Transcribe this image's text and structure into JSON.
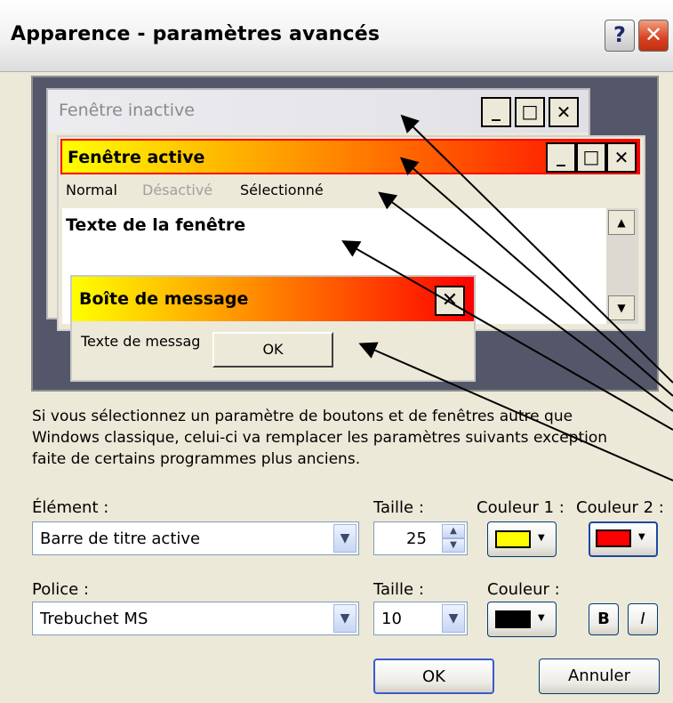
{
  "window": {
    "title": "Apparence - paramètres avancés",
    "help_symbol": "?",
    "close_symbol": "✕"
  },
  "preview": {
    "inactive_title": "Fenêtre inactive",
    "active_title": "Fenêtre active",
    "menu": {
      "normal": "Normal",
      "disabled": "Désactivé",
      "selected": "Sélectionné"
    },
    "window_text": "Texte de la fenêtre",
    "msgbox": {
      "title": "Boîte de message",
      "text": "Texte de messag",
      "ok": "OK"
    },
    "caption_buttons": {
      "minimize": "_",
      "maximize": "□",
      "close": "✕"
    }
  },
  "info_text": [
    "Si vous sélectionnez un paramètre de boutons et de fenêtres autre que",
    "Windows classique, celui-ci va remplacer les paramètres suivants exception",
    "faite de certains programmes plus anciens."
  ],
  "element": {
    "label": "Élément :",
    "value": "Barre de titre active",
    "size_label": "Taille :",
    "size_value": "25",
    "color1_label": "Couleur 1 :",
    "color2_label": "Couleur 2 :",
    "color1": "#ffff00",
    "color2": "#ff0000"
  },
  "font": {
    "label": "Police :",
    "value": "Trebuchet MS",
    "size_label": "Taille :",
    "size_value": "10",
    "color_label": "Couleur :",
    "color": "#000000",
    "bold_label": "B",
    "italic_label": "I"
  },
  "buttons": {
    "ok": "OK",
    "cancel": "Annuler"
  },
  "colors": {
    "dialog_bg": "#ece9d8",
    "preview_bg": "#545769",
    "active_gradient_start": "#ffff00",
    "active_gradient_end": "#ff0000",
    "disabled_text": "#a0a0a0"
  }
}
